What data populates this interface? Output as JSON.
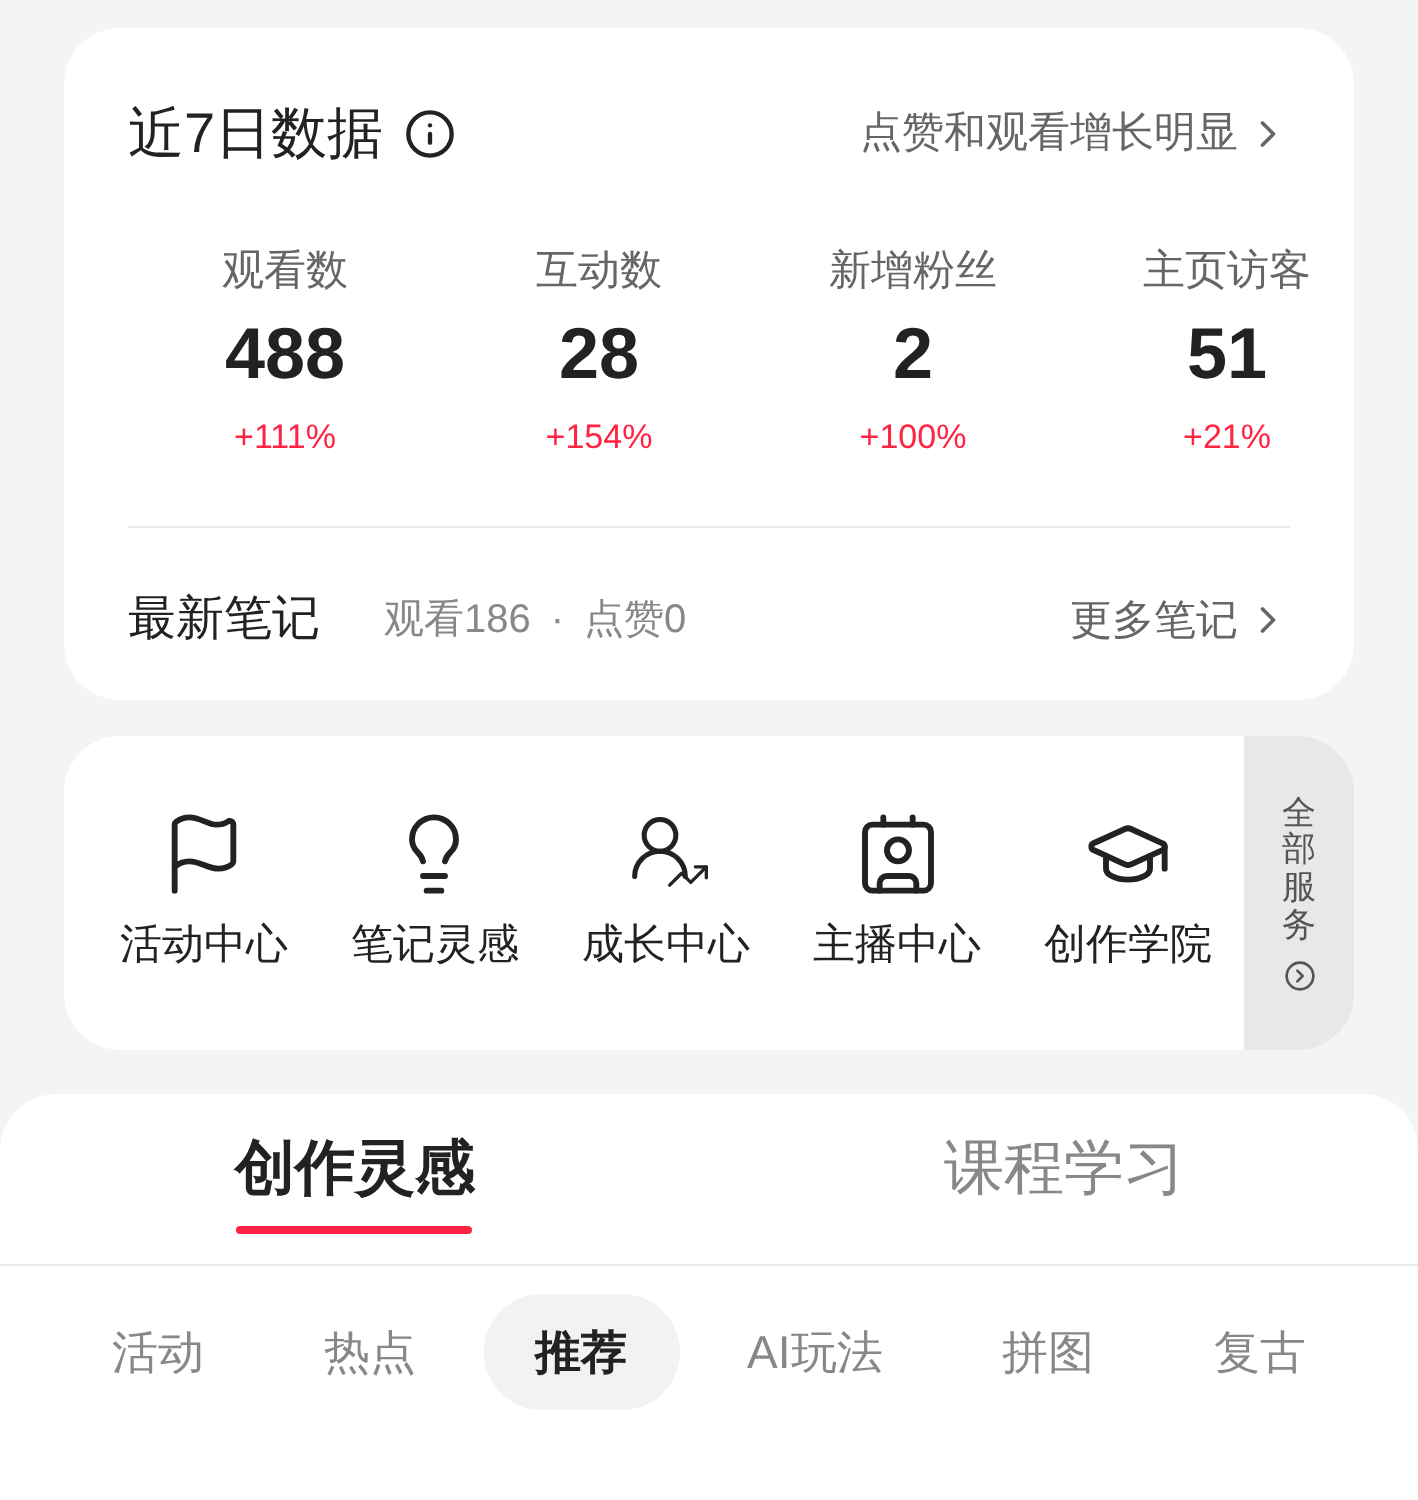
{
  "summary": {
    "title": "近7日数据",
    "hint": "点赞和观看增长明显",
    "stats": [
      {
        "label": "观看数",
        "value": "488",
        "change": "+111%"
      },
      {
        "label": "互动数",
        "value": "28",
        "change": "+154%"
      },
      {
        "label": "新增粉丝",
        "value": "2",
        "change": "+100%"
      },
      {
        "label": "主页访客",
        "value": "51",
        "change": "+21%"
      }
    ],
    "latest": {
      "title": "最新笔记",
      "views": "观看186",
      "separator": "·",
      "likes": "点赞0",
      "more": "更多笔记"
    }
  },
  "services": {
    "items": [
      {
        "kind": "flag",
        "label": "活动中心"
      },
      {
        "kind": "bulb",
        "label": "笔记灵感"
      },
      {
        "kind": "growth",
        "label": "成长中心"
      },
      {
        "kind": "anchor",
        "label": "主播中心"
      },
      {
        "kind": "cap",
        "label": "创作学院"
      }
    ],
    "all": "全部服务"
  },
  "tabs": [
    {
      "label": "创作灵感",
      "selected": true
    },
    {
      "label": "课程学习",
      "selected": false
    }
  ],
  "subtabs": [
    {
      "label": "活动",
      "selected": false
    },
    {
      "label": "热点",
      "selected": false
    },
    {
      "label": "推荐",
      "selected": true
    },
    {
      "label": "AI玩法",
      "selected": false
    },
    {
      "label": "拼图",
      "selected": false
    },
    {
      "label": "复古",
      "selected": false
    }
  ]
}
